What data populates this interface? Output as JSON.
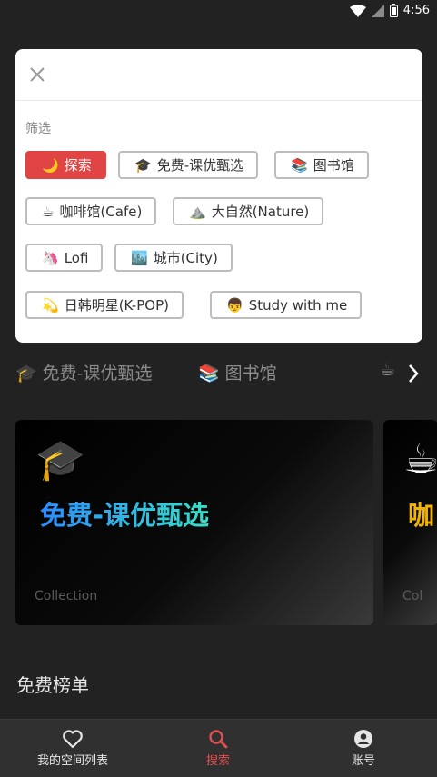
{
  "status_bar": {
    "time": "4:56"
  },
  "dialog": {
    "filter_label": "筛选",
    "chips": [
      {
        "emoji": "🌙",
        "label": "探索",
        "active": true
      },
      {
        "emoji": "🎓",
        "label": "免费-课优甄选",
        "active": false
      },
      {
        "emoji": "📚",
        "label": "图书馆",
        "active": false
      },
      {
        "emoji": "☕",
        "label": "咖啡馆(Cafe)",
        "active": false
      },
      {
        "emoji": "⛰️",
        "label": "大自然(Nature)",
        "active": false
      },
      {
        "emoji": "🦄",
        "label": "Lofi",
        "active": false
      },
      {
        "emoji": "🏙️",
        "label": "城市(City)",
        "active": false
      },
      {
        "emoji": "💫",
        "label": "日韩明星(K-POP)",
        "active": false
      },
      {
        "emoji": "👦",
        "label": "Study with me",
        "active": false
      }
    ]
  },
  "background": {
    "tabs": [
      {
        "emoji": "🎓",
        "label": "免费-课优甄选"
      },
      {
        "emoji": "📚",
        "label": "图书馆"
      },
      {
        "emoji": "☕",
        "label": ""
      }
    ],
    "cards": [
      {
        "emoji": "🎓",
        "title": "免费-课优甄选",
        "subtitle": "Collection"
      },
      {
        "emoji": "☕",
        "title": "咖",
        "subtitle": "Col"
      }
    ],
    "section_title": "免费榜单"
  },
  "bottom_nav": {
    "items": [
      {
        "label": "我的空间列表",
        "icon": "heart-icon",
        "active": false
      },
      {
        "label": "搜索",
        "icon": "search-icon",
        "active": true
      },
      {
        "label": "账号",
        "icon": "account-icon",
        "active": false
      }
    ]
  },
  "colors": {
    "accent": "#e04444",
    "background": "#222222",
    "nav_background": "#303030"
  }
}
